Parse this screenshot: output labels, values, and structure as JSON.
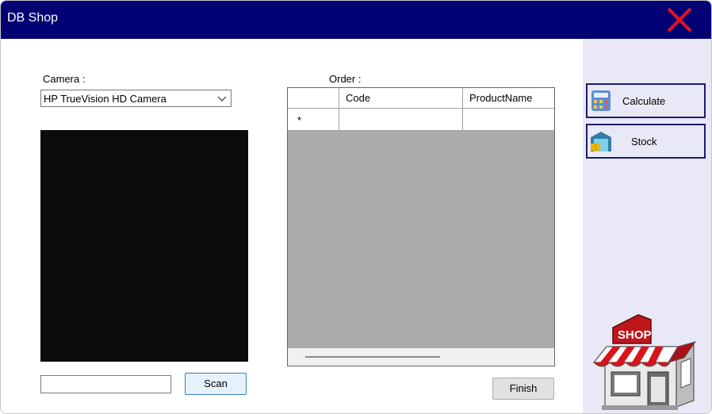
{
  "window": {
    "title": "DB Shop"
  },
  "camera": {
    "label": "Camera :",
    "selected": "HP TrueVision HD Camera"
  },
  "scan": {
    "input_value": "",
    "button_label": "Scan"
  },
  "order": {
    "label": "Order :",
    "columns": [
      "Code",
      "ProductName"
    ],
    "new_row_marker": "*"
  },
  "finish_label": "Finish",
  "side": {
    "calculate_label": "Calculate",
    "stock_label": "Stock",
    "shop_sign": "SHOP"
  },
  "colors": {
    "titlebar": "#010173",
    "close": "#e81123",
    "side_panel": "#e8e8f6",
    "grid_background": "#ababab"
  }
}
